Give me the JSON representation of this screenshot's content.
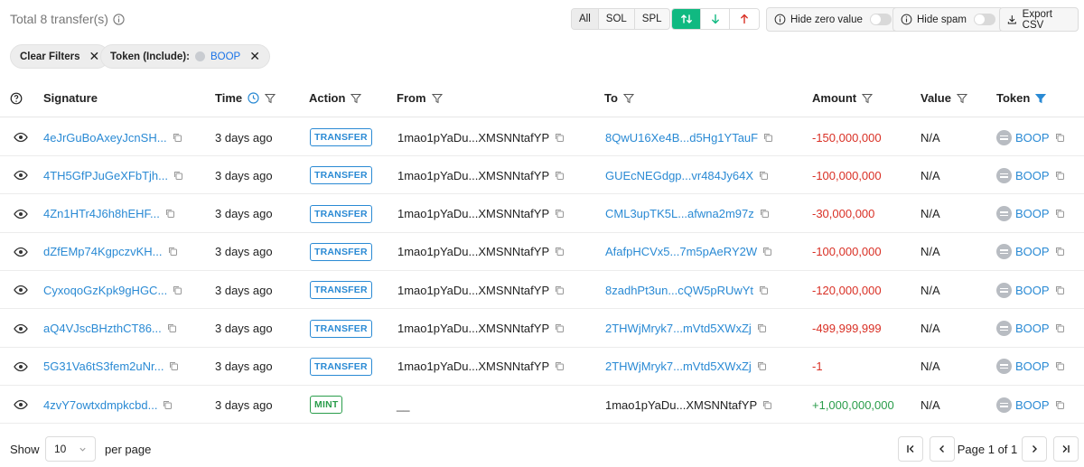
{
  "header": {
    "total_label": "Total 8 transfer(s)",
    "type_filters": [
      "All",
      "SOL",
      "SPL"
    ],
    "hide_zero_label": "Hide zero value",
    "hide_spam_label": "Hide spam",
    "export_label": "Export CSV"
  },
  "filters": {
    "clear_label": "Clear Filters",
    "token_chip_prefix": "Token (Include):",
    "token_chip_value": "BOOP"
  },
  "columns": {
    "signature": "Signature",
    "time": "Time",
    "action": "Action",
    "from": "From",
    "to": "To",
    "amount": "Amount",
    "value": "Value",
    "token": "Token"
  },
  "rows": [
    {
      "signature": "4eJrGuBoAxeyJcnSH...",
      "time": "3 days ago",
      "action": "TRANSFER",
      "from": "1mao1pYaDu...XMSNNtafYP",
      "to": "8QwU16Xe4B...d5Hg1YTauF",
      "amount": "-150,000,000",
      "value": "N/A",
      "token": "BOOP"
    },
    {
      "signature": "4TH5GfPJuGeXFbTjh...",
      "time": "3 days ago",
      "action": "TRANSFER",
      "from": "1mao1pYaDu...XMSNNtafYP",
      "to": "GUEcNEGdgp...vr484Jy64X",
      "amount": "-100,000,000",
      "value": "N/A",
      "token": "BOOP"
    },
    {
      "signature": "4Zn1HTr4J6h8hEHF...",
      "time": "3 days ago",
      "action": "TRANSFER",
      "from": "1mao1pYaDu...XMSNNtafYP",
      "to": "CML3upTK5L...afwna2m97z",
      "amount": "-30,000,000",
      "value": "N/A",
      "token": "BOOP"
    },
    {
      "signature": "dZfEMp74KgpczvKH...",
      "time": "3 days ago",
      "action": "TRANSFER",
      "from": "1mao1pYaDu...XMSNNtafYP",
      "to": "AfafpHCVx5...7m5pAeRY2W",
      "amount": "-100,000,000",
      "value": "N/A",
      "token": "BOOP"
    },
    {
      "signature": "CyxoqoGzKpk9gHGC...",
      "time": "3 days ago",
      "action": "TRANSFER",
      "from": "1mao1pYaDu...XMSNNtafYP",
      "to": "8zadhPt3un...cQW5pRUwYt",
      "amount": "-120,000,000",
      "value": "N/A",
      "token": "BOOP"
    },
    {
      "signature": "aQ4VJscBHzthCT86...",
      "time": "3 days ago",
      "action": "TRANSFER",
      "from": "1mao1pYaDu...XMSNNtafYP",
      "to": "2THWjMryk7...mVtd5XWxZj",
      "amount": "-499,999,999",
      "value": "N/A",
      "token": "BOOP"
    },
    {
      "signature": "5G31Va6tS3fem2uNr...",
      "time": "3 days ago",
      "action": "TRANSFER",
      "from": "1mao1pYaDu...XMSNNtafYP",
      "to": "2THWjMryk7...mVtd5XWxZj",
      "amount": "-1",
      "value": "N/A",
      "token": "BOOP"
    },
    {
      "signature": "4zvY7owtxdmpkcbd...",
      "time": "3 days ago",
      "action": "MINT",
      "from": "__",
      "to": "1mao1pYaDu...XMSNNtafYP",
      "amount": "+1,000,000,000",
      "value": "N/A",
      "token": "BOOP"
    }
  ],
  "footer": {
    "show_label": "Show",
    "page_size": "10",
    "per_page_label": "per page",
    "page_info": "Page 1 of 1"
  },
  "colors": {
    "accent_green": "#10b981",
    "link_blue": "#2a8ad4",
    "negative_red": "#d93025",
    "positive_green": "#2a9d4b"
  }
}
